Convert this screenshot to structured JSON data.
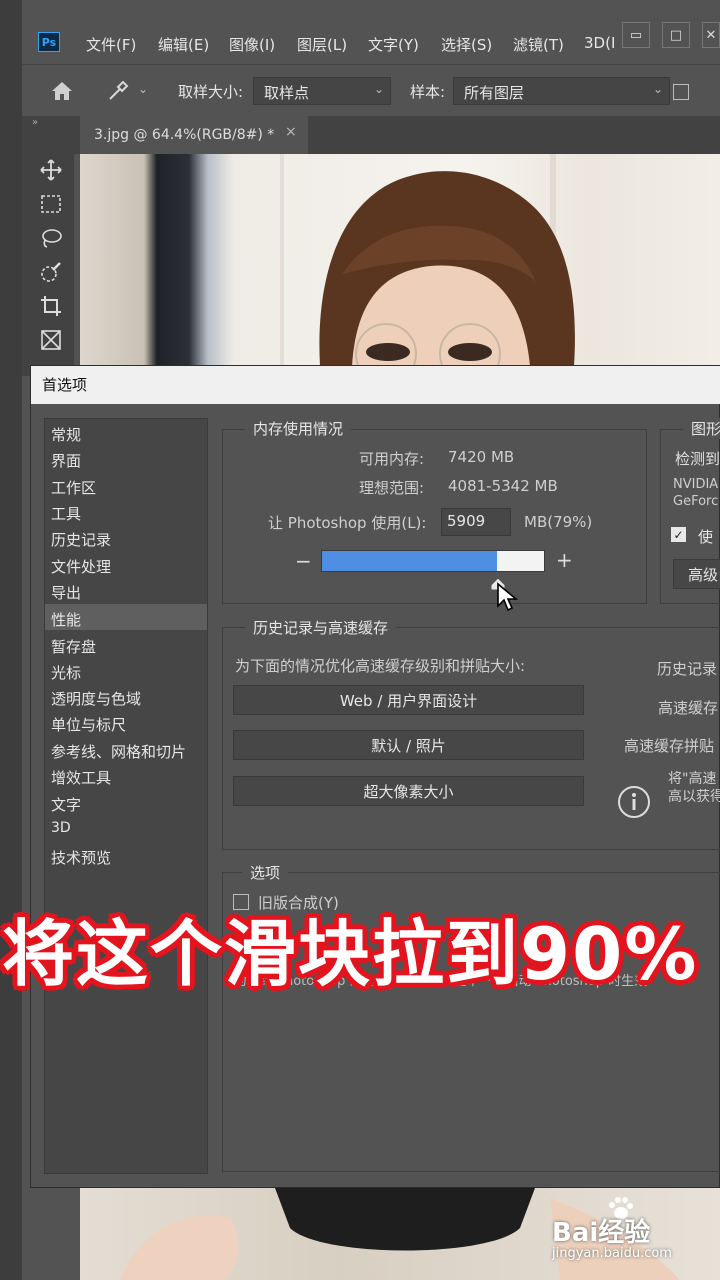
{
  "app": {
    "logo": "Ps",
    "menu": [
      "文件(F)",
      "编辑(E)",
      "图像(I)",
      "图层(L)",
      "文字(Y)",
      "选择(S)",
      "滤镜(T)",
      "3D(I"
    ],
    "window_buttons": {
      "minimize": "▭",
      "restore": "□",
      "close": "✕"
    }
  },
  "options_bar": {
    "sample_size_label": "取样大小:",
    "sample_size_value": "取样点",
    "sample_label": "样本:",
    "sample_value": "所有图层"
  },
  "tools": [
    "move-icon",
    "marquee-icon",
    "lasso-icon",
    "quick-select-icon",
    "crop-icon",
    "frame-icon"
  ],
  "document_tab": {
    "title": "3.jpg @ 64.4%(RGB/8#) *",
    "close": "×"
  },
  "dialog": {
    "title": "首选项",
    "sidebar": [
      "常规",
      "界面",
      "工作区",
      "工具",
      "历史记录",
      "文件处理",
      "导出",
      "性能",
      "暂存盘",
      "光标",
      "透明度与色域",
      "单位与标尺",
      "参考线、网格和切片",
      "增效工具",
      "文字",
      "3D",
      "技术预览"
    ],
    "active_item": "性能",
    "memory": {
      "title": "内存使用情况",
      "available_label": "可用内存:",
      "available_value": "7420 MB",
      "ideal_label": "理想范围:",
      "ideal_value": "4081-5342 MB",
      "let_label": "让 Photoshop 使用(L):",
      "use_value": "5909",
      "use_suffix": "MB(79%)",
      "slider_percent": 79,
      "minus": "−",
      "plus": "+"
    },
    "graphics": {
      "title": "图形",
      "detected": "检测到",
      "gpu_line1": "NVIDIA",
      "gpu_line2": "GeForc",
      "use_checkbox": "使",
      "advanced_button": "高级"
    },
    "history": {
      "title": "历史记录与高速缓存",
      "instruction": "为下面的情况优化高速缓存级别和拼贴大小:",
      "buttons": [
        "Web / 用户界面设计",
        "默认 / 照片",
        "超大像素大小"
      ],
      "right_labels": [
        "历史记录",
        "高速缓存",
        "高速缓存拼贴"
      ],
      "info_line1": "将\"高速",
      "info_line2": "高以获得"
    },
    "options": {
      "title": "选项",
      "legacy_checkbox": "旧版合成(Y)",
      "note": "为能给 Photoshop 的内存量。更改将在下一次启动 Photoshop 时生效"
    }
  },
  "overlay_caption": "将这个滑块拉到90%",
  "watermark": {
    "brand": "Bai经验",
    "url": "jingyan.baidu.com"
  }
}
